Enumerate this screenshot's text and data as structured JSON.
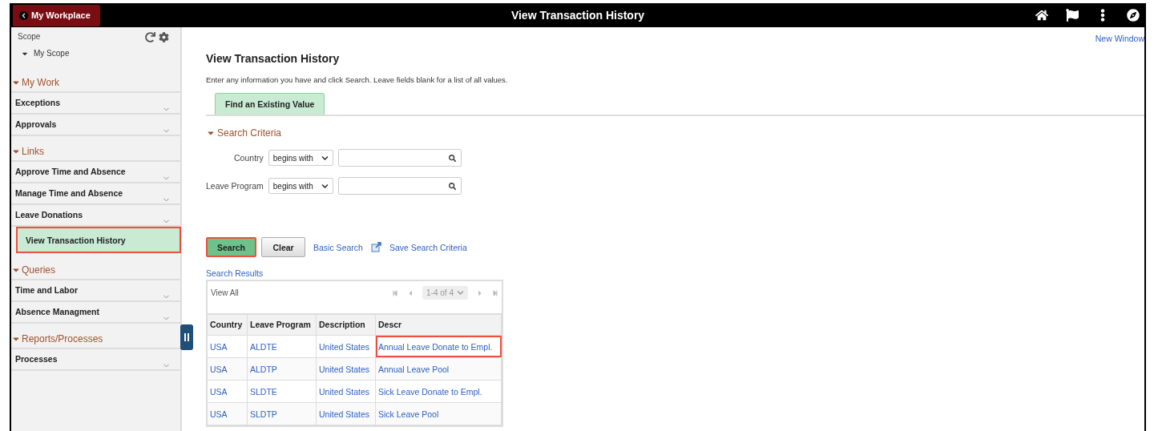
{
  "header": {
    "back_button": "My Workplace",
    "title": "View Transaction History"
  },
  "sidebar": {
    "scope_label": "Scope",
    "scope_item": {
      "label": "My Scope",
      "expanded": true
    },
    "sections": [
      {
        "title": "My Work",
        "expanded": true,
        "items": [
          {
            "label": "Exceptions",
            "selected": false,
            "highlighted": false
          },
          {
            "label": "Approvals",
            "selected": false,
            "highlighted": false
          }
        ]
      },
      {
        "title": "Links",
        "expanded": true,
        "items": [
          {
            "label": "Approve Time and Absence",
            "selected": false,
            "highlighted": false
          },
          {
            "label": "Manage Time and Absence",
            "selected": false,
            "highlighted": false
          },
          {
            "label": "Leave Donations",
            "selected": false,
            "highlighted": false,
            "children": [
              {
                "label": "View Transaction History",
                "selected": true,
                "highlighted": true
              }
            ]
          }
        ]
      },
      {
        "title": "Queries",
        "expanded": true,
        "items": [
          {
            "label": "Time and Labor",
            "selected": false,
            "highlighted": false
          },
          {
            "label": "Absence Managment",
            "selected": false,
            "highlighted": false
          }
        ]
      },
      {
        "title": "Reports/Processes",
        "expanded": true,
        "items": [
          {
            "label": "Processes",
            "selected": false,
            "highlighted": false
          }
        ]
      }
    ]
  },
  "main": {
    "new_window": "New Window",
    "title": "View Transaction History",
    "instructions": "Enter any information you have and click Search. Leave fields blank for a list of all values.",
    "tabs": [
      {
        "label": "Find an Existing Value",
        "selected": true
      }
    ],
    "search_criteria": {
      "title": "Search Criteria",
      "expanded": true,
      "fields": [
        {
          "label": "Country",
          "operator": "begins with"
        },
        {
          "label": "Leave Program",
          "operator": "begins with"
        }
      ]
    },
    "buttons": [
      {
        "label": "Search",
        "kind": "primary",
        "highlighted": true
      },
      {
        "label": "Clear",
        "kind": "secondary",
        "highlighted": false
      }
    ],
    "links": [
      {
        "label": "Basic Search",
        "kind": "plain"
      },
      {
        "label": "Save Search Criteria",
        "kind": "icon"
      }
    ],
    "results": {
      "title": "Search Results",
      "view_all": "View All",
      "pager": "1-4 of 4",
      "columns": [
        "Country",
        "Leave Program",
        "Description",
        "Descr"
      ],
      "rows": [
        {
          "cells": [
            {
              "text": "USA",
              "highlighted": false
            },
            {
              "text": "ALDTE",
              "highlighted": false
            },
            {
              "text": "United States",
              "highlighted": false
            },
            {
              "text": "Annual Leave Donate to Empl.",
              "highlighted": true
            }
          ]
        },
        {
          "cells": [
            {
              "text": "USA",
              "highlighted": false
            },
            {
              "text": "ALDTP",
              "highlighted": false
            },
            {
              "text": "United States",
              "highlighted": false
            },
            {
              "text": "Annual Leave Pool",
              "highlighted": false
            }
          ]
        },
        {
          "cells": [
            {
              "text": "USA",
              "highlighted": false
            },
            {
              "text": "SLDTE",
              "highlighted": false
            },
            {
              "text": "United States",
              "highlighted": false
            },
            {
              "text": "Sick Leave Donate to Empl.",
              "highlighted": false
            }
          ]
        },
        {
          "cells": [
            {
              "text": "USA",
              "highlighted": false
            },
            {
              "text": "SLDTP",
              "highlighted": false
            },
            {
              "text": "United States",
              "highlighted": false
            },
            {
              "text": "Sick Leave Pool",
              "highlighted": false
            }
          ]
        }
      ]
    }
  }
}
